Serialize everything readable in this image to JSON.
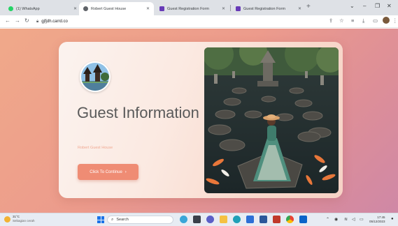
{
  "browser": {
    "tabs": [
      {
        "label": "(1) WhatsApp",
        "icon": "whatsapp-icon",
        "icon_color": "#25d366",
        "active": false
      },
      {
        "label": "Robert Guest House",
        "icon": "site-icon",
        "icon_color": "#5f6368",
        "active": true
      },
      {
        "label": "Guest Registration Form",
        "icon": "forms-icon",
        "icon_color": "#673ab7",
        "active": false
      },
      {
        "label": "Guest Registration Form",
        "icon": "forms-icon",
        "icon_color": "#673ab7",
        "active": false
      }
    ],
    "url": "gjfjdh.carrd.co"
  },
  "page": {
    "title": "Guest Information",
    "subtitle": "Robert Guest House",
    "cta_label": "Click To Continue",
    "cta_arrow": "›"
  },
  "taskbar": {
    "weather_temp": "31°C",
    "weather_desc": "Sebagian cerah",
    "search_label": "Search",
    "time": "17:45",
    "date": "05/12/2023"
  },
  "colors": {
    "accent": "#ef8c74",
    "background_gradient": [
      "#f0a98a",
      "#cf88a6"
    ],
    "title": "#5a5a5a"
  }
}
